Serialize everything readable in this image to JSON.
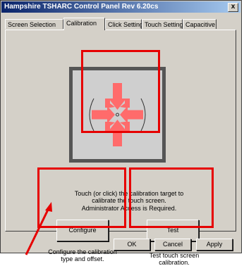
{
  "window": {
    "title": "Hampshire TSHARC Control Panel Rev 6.20cs",
    "close_label": "x"
  },
  "tabs": [
    {
      "label": "Screen Selection"
    },
    {
      "label": "Calibration",
      "active": true
    },
    {
      "label": "Click Settings"
    },
    {
      "label": "Touch Settings"
    },
    {
      "label": "Capacitive"
    }
  ],
  "calibration": {
    "description": "Touch (or click) the calibration target to calibrate the touch screen.",
    "admin_note": "Administrator Access is Required.",
    "configure": {
      "label": "Configure",
      "caption": "Configure the calibration type and offset."
    },
    "test": {
      "label": "Test",
      "caption": "Test touch screen calibration."
    }
  },
  "footer": {
    "ok": "OK",
    "cancel": "Cancel",
    "apply": "Apply"
  },
  "colors": {
    "highlight": "#e60000",
    "target": "#ff6b6b",
    "title_start": "#0a246a",
    "title_end": "#a6caf0"
  },
  "icons": [
    "calibration-target-icon",
    "arrow-pointer-icon",
    "close-icon"
  ]
}
